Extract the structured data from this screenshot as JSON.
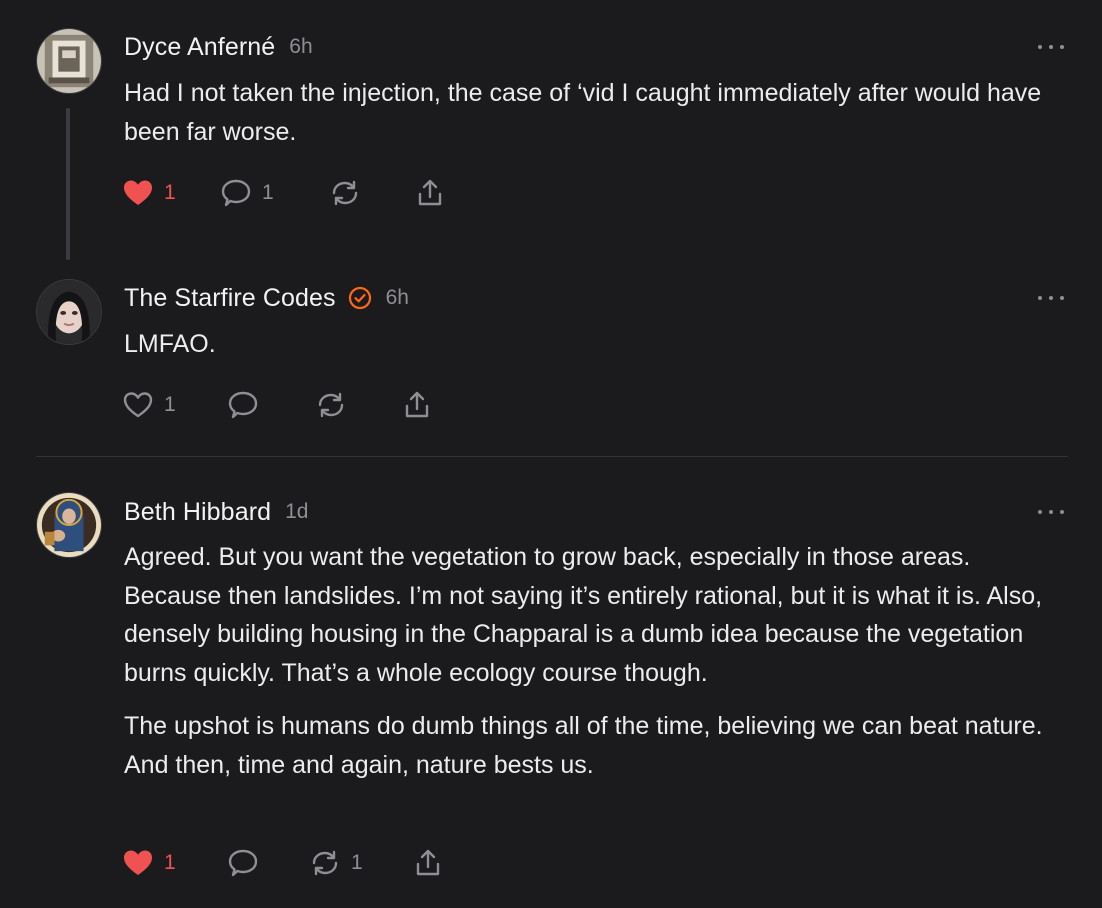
{
  "comments": [
    {
      "author": "Dyce Anferné",
      "time": "6h",
      "verified": false,
      "paragraphs": [
        "Had I not taken the injection, the case of ‘vid I caught immediately after would have been far worse."
      ],
      "likes": "1",
      "liked": true,
      "replies": "1",
      "restacks": ""
    },
    {
      "author": "The Starfire Codes",
      "time": "6h",
      "verified": true,
      "paragraphs": [
        "LMFAO."
      ],
      "likes": "1",
      "liked": false,
      "replies": "",
      "restacks": ""
    },
    {
      "author": "Beth Hibbard",
      "time": "1d",
      "verified": false,
      "paragraphs": [
        "Agreed. But you want the vegetation to grow back, especially in those areas. Because then landslides. I’m not saying it’s entirely rational, but it is what it is. Also, densely building housing in the Chapparal is a dumb idea because the vegetation burns quickly. That’s a whole ecology course though.",
        "The upshot is humans do dumb things all of the time, believing we can beat nature. And then, time and again, nature bests us."
      ],
      "likes": "1",
      "liked": true,
      "replies": "",
      "restacks": "1"
    }
  ],
  "icons": {
    "like": "heart-icon",
    "reply": "comment-bubble-icon",
    "restack": "restack-icon",
    "share": "share-icon",
    "more": "more-options-icon",
    "verified": "verified-badge-icon"
  },
  "colors": {
    "background": "#1b1b1e",
    "text": "#ececef",
    "muted": "#8e8e94",
    "heart": "#f05252",
    "verified": "#ff6719"
  }
}
